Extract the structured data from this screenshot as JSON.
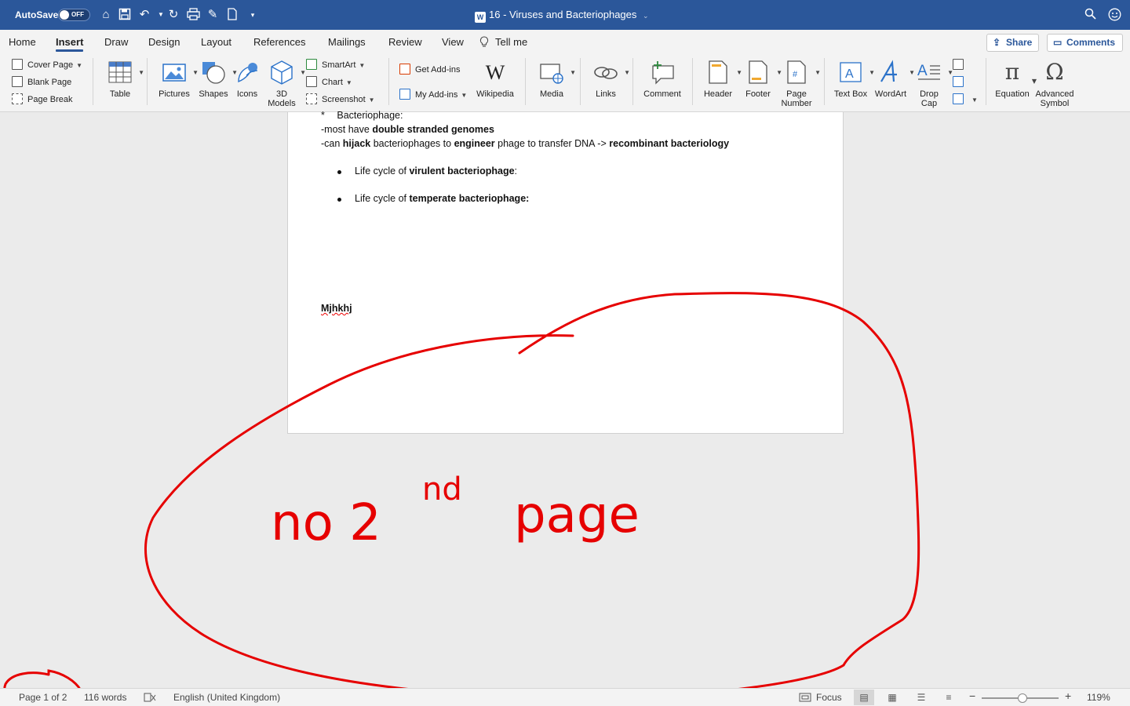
{
  "titlebar": {
    "autosave_label": "AutoSave",
    "autosave_state": "OFF",
    "document_title": "16 - Viruses and Bacteriophages"
  },
  "tabs": [
    "Home",
    "Insert",
    "Draw",
    "Design",
    "Layout",
    "References",
    "Mailings",
    "Review",
    "View",
    "Tell me"
  ],
  "active_tab": "Insert",
  "share_label": "Share",
  "comments_label": "Comments",
  "ribbon": {
    "pages": [
      "Cover Page",
      "Blank Page",
      "Page Break"
    ],
    "table": "Table",
    "pictures": "Pictures",
    "shapes": "Shapes",
    "icons": "Icons",
    "models_line1": "3D",
    "models_line2": "Models",
    "smartart": "SmartArt",
    "chart": "Chart",
    "screenshot": "Screenshot",
    "get_addins": "Get Add-ins",
    "my_addins": "My Add-ins",
    "wikipedia": "Wikipedia",
    "media": "Media",
    "links": "Links",
    "comment": "Comment",
    "header": "Header",
    "footer": "Footer",
    "page_number_line1": "Page",
    "page_number_line2": "Number",
    "text_box": "Text Box",
    "wordart": "WordArt",
    "drop_cap_line1": "Drop",
    "drop_cap_line2": "Cap",
    "equation": "Equation",
    "advanced_symbol_line1": "Advanced",
    "advanced_symbol_line2": "Symbol"
  },
  "document": {
    "line1_marker": "*",
    "line1_text": "Bacteriophage:",
    "line2_a": "-most have ",
    "line2_b": "double stranded genomes",
    "line3_a": "-can ",
    "line3_b": "hijack",
    "line3_c": " bacteriophages to ",
    "line3_d": "engineer",
    "line3_e": " phage to transfer DNA -> ",
    "line3_f": "recombinant bacteriology",
    "bullet1_a": "Life cycle of ",
    "bullet1_b": "virulent bacteriophage",
    "bullet1_c": ":",
    "bullet2_a": "Life cycle of ",
    "bullet2_b": "temperate bacteriophage:",
    "typo_word": "Mjhkhj"
  },
  "annotation": {
    "text_a": "no 2",
    "text_sup": "nd",
    "text_b": "page",
    "color": "#e60000"
  },
  "statusbar": {
    "page": "Page 1 of 2",
    "words": "116 words",
    "language": "English (United Kingdom)",
    "focus": "Focus",
    "zoom": "119%"
  }
}
